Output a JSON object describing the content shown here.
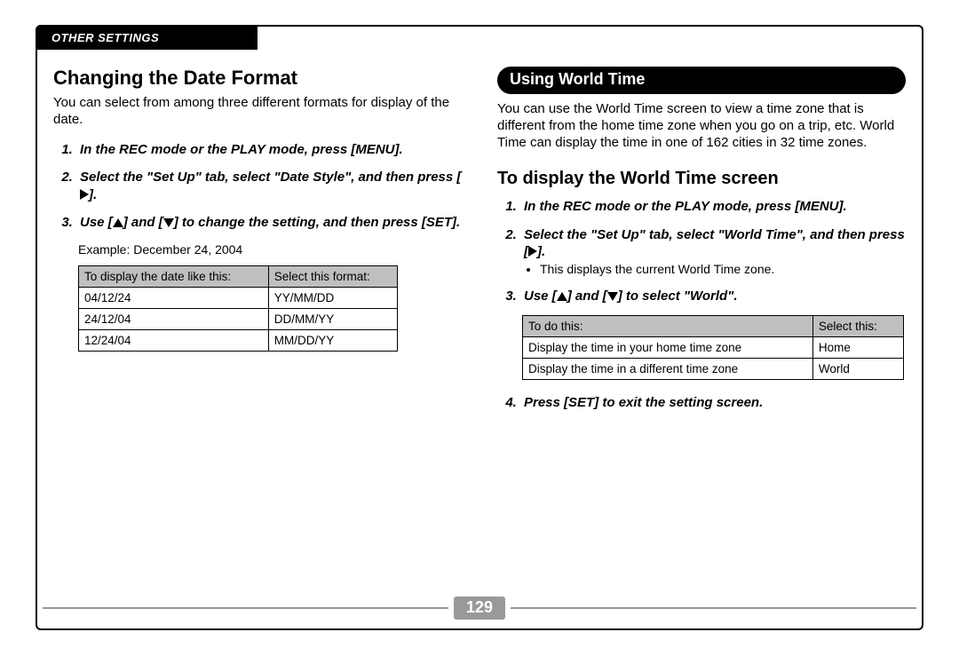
{
  "sectionBar": "OTHER SETTINGS",
  "pageNumber": "129",
  "left": {
    "heading": "Changing the Date Format",
    "intro": "You can select from among three different formats for display of the date.",
    "steps": {
      "s1": "In the REC mode or the PLAY mode, press [MENU].",
      "s2a": "Select the \"Set Up\" tab, select \"Date Style\", and then press [",
      "s2b": "].",
      "s3a": "Use [",
      "s3b": "] and [",
      "s3c": "] to change the setting, and then press [SET]."
    },
    "example": "Example: December 24, 2004",
    "table": {
      "h1": "To display the date like this:",
      "h2": "Select this format:",
      "rows": [
        {
          "c1": "04/12/24",
          "c2": "YY/MM/DD"
        },
        {
          "c1": "24/12/04",
          "c2": "DD/MM/YY"
        },
        {
          "c1": "12/24/04",
          "c2": "MM/DD/YY"
        }
      ]
    }
  },
  "right": {
    "pill": "Using World Time",
    "intro": "You can use the World Time screen to view a time zone that is different from the home time zone when you go on a trip, etc. World Time can display the time in one of 162 cities in 32 time zones.",
    "subheading": "To display the World Time screen",
    "steps": {
      "s1": "In the REC mode or the PLAY mode, press [MENU].",
      "s2a": "Select the \"Set Up\" tab, select \"World Time\", and then press [",
      "s2b": "].",
      "s2note": "This displays the current World Time zone.",
      "s3a": "Use [",
      "s3b": "] and [",
      "s3c": "] to select \"World\".",
      "s4": "Press [SET] to exit the setting screen."
    },
    "table": {
      "h1": "To do this:",
      "h2": "Select this:",
      "rows": [
        {
          "c1": "Display the time in your home time zone",
          "c2": "Home"
        },
        {
          "c1": "Display the time in a different time zone",
          "c2": "World"
        }
      ]
    }
  }
}
